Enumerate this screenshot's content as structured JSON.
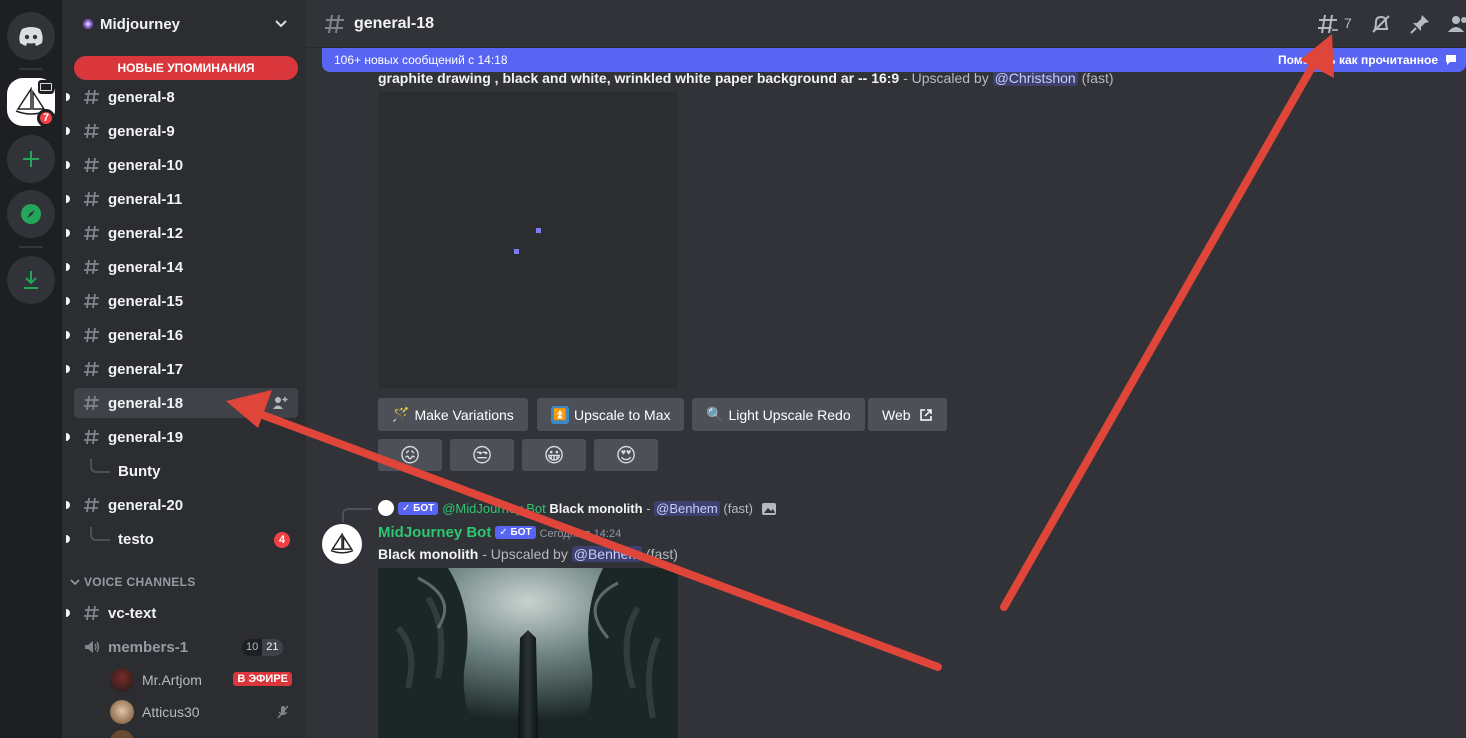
{
  "server": {
    "name": "Midjourney",
    "rail_badge": "7"
  },
  "mentions_pill": "НОВЫЕ УПОМИНАНИЯ",
  "channels": [
    {
      "label": "general-8"
    },
    {
      "label": "general-9"
    },
    {
      "label": "general-10"
    },
    {
      "label": "general-11"
    },
    {
      "label": "general-12"
    },
    {
      "label": "general-14"
    },
    {
      "label": "general-15"
    },
    {
      "label": "general-16"
    },
    {
      "label": "general-17"
    },
    {
      "label": "general-18"
    },
    {
      "label": "general-19"
    },
    {
      "label": "Bunty"
    },
    {
      "label": "general-20"
    },
    {
      "label": "testo",
      "badge": "4"
    }
  ],
  "voice_category": "VOICE CHANNELS",
  "voice": {
    "text_channel": "vc-text",
    "channel": "members-1",
    "count_a": "10",
    "count_b": "21",
    "members": [
      {
        "name": "Mr.Artjom",
        "live": "В ЭФИРЕ"
      },
      {
        "name": "Atticus30"
      }
    ]
  },
  "topbar": {
    "channel_title": "general-18",
    "thread_count": "7"
  },
  "new_messages": {
    "text": "106+ новых сообщений с 14:18",
    "mark_read": "Пометить как прочитанное"
  },
  "message1": {
    "prompt": "graphite drawing , black and white, wrinkled white paper background ar -- 16:9",
    "suffix": " - Upscaled by ",
    "mention": "@Christshon",
    "mode": " (fast)"
  },
  "buttons": {
    "make_variations": "Make Variations",
    "upscale_to_max": "Upscale to Max",
    "light_upscale_redo": "Light Upscale Redo",
    "web": "Web"
  },
  "reactions": [
    "😖",
    "😒",
    "😀",
    "😍"
  ],
  "reply": {
    "bot_tag": "✓ БОТ",
    "author": "@MidJourney Bot",
    "prompt": "Black monolith",
    "dash": " - ",
    "mention": "@Benhem",
    "mode": " (fast)"
  },
  "message2": {
    "author": "MidJourney Bot",
    "bot_tag": "✓ БОТ",
    "timestamp": "Сегодня в 14:24",
    "prompt": "Black monolith",
    "suffix": " - Upscaled by ",
    "mention": "@Benhem",
    "mode": " (fast)"
  },
  "colors": {
    "accent": "#5865f2",
    "danger": "#da373c",
    "bot_name": "#2dc770",
    "arrow": "#e0453a"
  }
}
